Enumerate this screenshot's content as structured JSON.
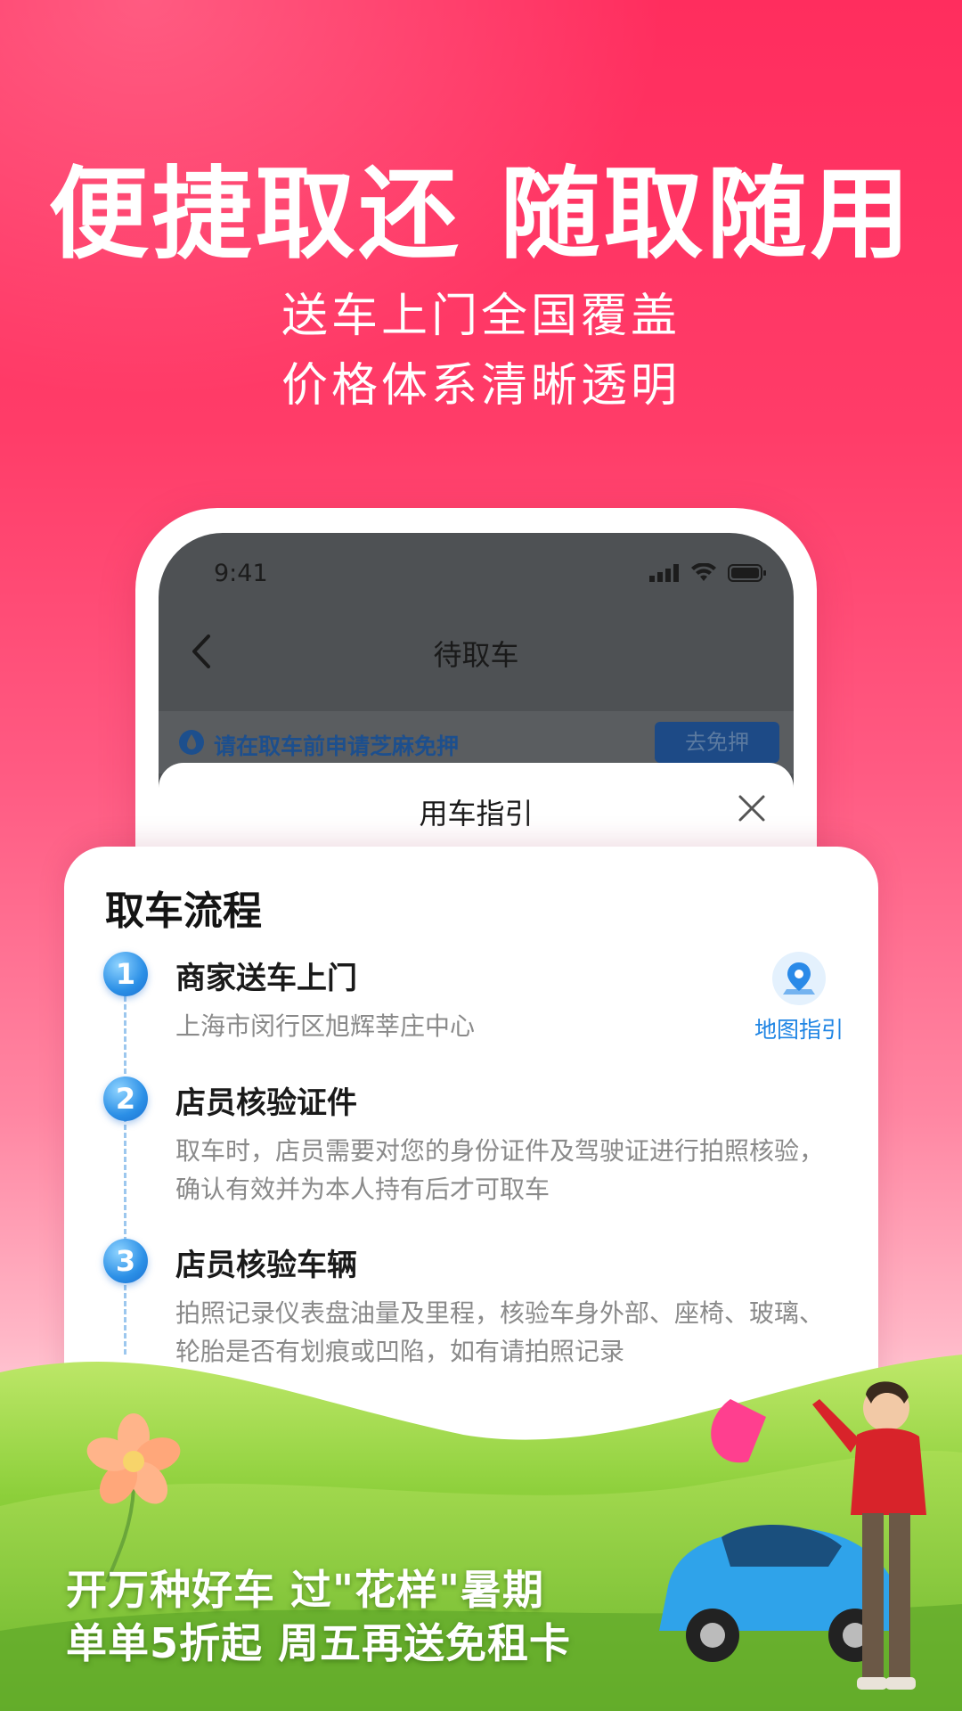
{
  "hero": {
    "headline": "便捷取还 随取随用",
    "sub1": "送车上门全国覆盖",
    "sub2": "价格体系清晰透明"
  },
  "phone": {
    "status_time": "9:41",
    "nav_title": "待取车",
    "notice_text": "请在取车前申请芝麻免押",
    "notice_button": "去免押",
    "sheet_title": "用车指引"
  },
  "card": {
    "title": "取车流程",
    "steps": [
      {
        "num": "1",
        "title": "商家送车上门",
        "desc": "上海市闵行区旭辉莘庄中心"
      },
      {
        "num": "2",
        "title": "店员核验证件",
        "desc": "取车时，店员需要对您的身份证件及驾驶证进行拍照核验，确认有效并为本人持有后才可取车"
      },
      {
        "num": "3",
        "title": "店员核验车辆",
        "desc": "拍照记录仪表盘油量及里程，核验车身外部、座椅、玻璃、轮胎是否有划痕或凹陷，如有请拍照记录"
      }
    ],
    "map_label": "地图指引"
  },
  "promo": {
    "line1": "开万种好车 过\"花样\"暑期",
    "line2": "单单5折起 周五再送免租卡"
  },
  "colors": {
    "accent_pink": "#ff2d5e",
    "accent_blue": "#1f85e4",
    "grass_green": "#8ccf3a"
  },
  "icons": [
    "back-icon",
    "signal-icon",
    "wifi-icon",
    "battery-icon",
    "shield-icon",
    "close-icon",
    "map-pin-icon"
  ]
}
